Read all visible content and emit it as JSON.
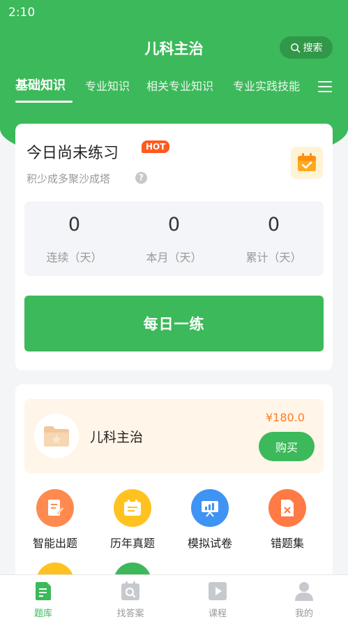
{
  "status_bar": {
    "time": "2:10"
  },
  "header": {
    "title": "儿科主治",
    "search_label": "搜索"
  },
  "tabs": [
    {
      "label": "基础知识",
      "active": true
    },
    {
      "label": "专业知识",
      "active": false
    },
    {
      "label": "相关专业知识",
      "active": false
    },
    {
      "label": "专业实践技能",
      "active": false
    }
  ],
  "practice": {
    "title": "今日尚未练习",
    "badge": "HOT",
    "subtitle": "积少成多聚沙成塔",
    "help": "?",
    "stats": [
      {
        "value": "0",
        "label": "连续（天）"
      },
      {
        "value": "0",
        "label": "本月（天）"
      },
      {
        "value": "0",
        "label": "累计（天）"
      }
    ],
    "daily_button": "每日一练"
  },
  "product": {
    "name": "儿科主治",
    "price": "¥180.0",
    "buy_label": "购买"
  },
  "features": [
    {
      "label": "智能出题",
      "icon": "smart-question-icon",
      "color": "#ff8a50"
    },
    {
      "label": "历年真题",
      "icon": "past-exam-icon",
      "color": "#ffc21f"
    },
    {
      "label": "模拟试卷",
      "icon": "mock-exam-icon",
      "color": "#3f93f5"
    },
    {
      "label": "错题集",
      "icon": "wrong-questions-icon",
      "color": "#ff7a45"
    }
  ],
  "bottom_nav": [
    {
      "label": "题库",
      "icon": "question-bank-icon",
      "active": true
    },
    {
      "label": "找答案",
      "icon": "find-answer-icon",
      "active": false
    },
    {
      "label": "课程",
      "icon": "course-icon",
      "active": false
    },
    {
      "label": "我的",
      "icon": "profile-icon",
      "active": false
    }
  ],
  "colors": {
    "brand": "#3cb95a",
    "hot": "#ff5a1f",
    "price": "#ff7d1e"
  }
}
